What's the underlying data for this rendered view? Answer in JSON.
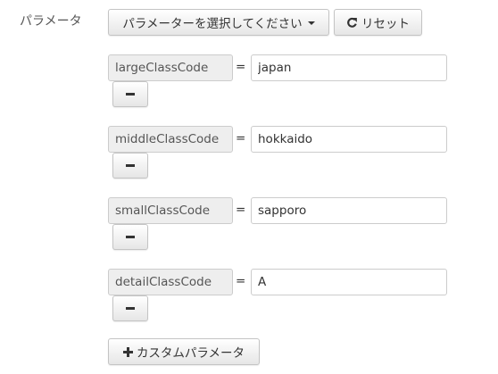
{
  "section": {
    "label": "パラメータ"
  },
  "toolbar": {
    "select_label": "パラメーターを選択してください",
    "reset_label": "リセット"
  },
  "params": [
    {
      "key": "largeClassCode",
      "equals": "=",
      "value": "japan"
    },
    {
      "key": "middleClassCode",
      "equals": "=",
      "value": "hokkaido"
    },
    {
      "key": "smallClassCode",
      "equals": "=",
      "value": "sapporo"
    },
    {
      "key": "detailClassCode",
      "equals": "=",
      "value": "A"
    }
  ],
  "custom": {
    "add_label": "カスタムパラメータ"
  },
  "icons": {
    "reset": "refresh-icon",
    "add": "plus-icon",
    "remove": "minus-icon",
    "dropdown": "caret-down-icon"
  }
}
